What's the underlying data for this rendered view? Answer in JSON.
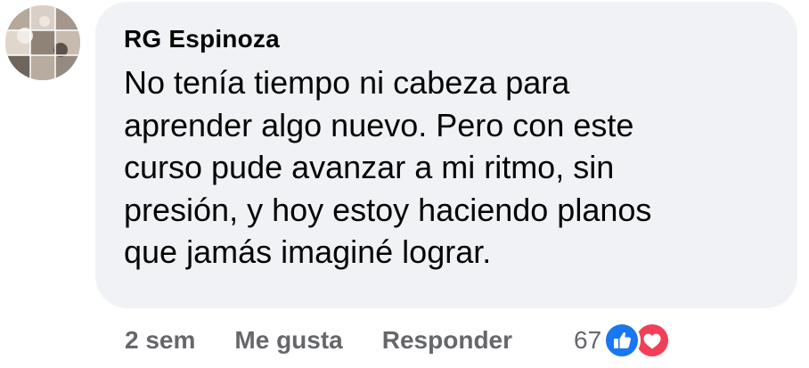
{
  "comment": {
    "author": "RG Espinoza",
    "text": "No tenía tiempo ni cabeza para\naprender algo nuevo. Pero con este\ncurso pude avanzar a mi ritmo, sin\npresión, y hoy estoy haciendo planos\nque jamás imaginé lograr.",
    "timestamp": "2 sem",
    "like_label": "Me gusta",
    "reply_label": "Responder",
    "reactions": {
      "count": "67",
      "icons": [
        "like-icon",
        "love-icon"
      ]
    }
  },
  "colors": {
    "bubble": "#f0f2f5",
    "text": "#050505",
    "secondary_text": "#65676b",
    "like": "#1877f2",
    "love": "#f33e58"
  }
}
